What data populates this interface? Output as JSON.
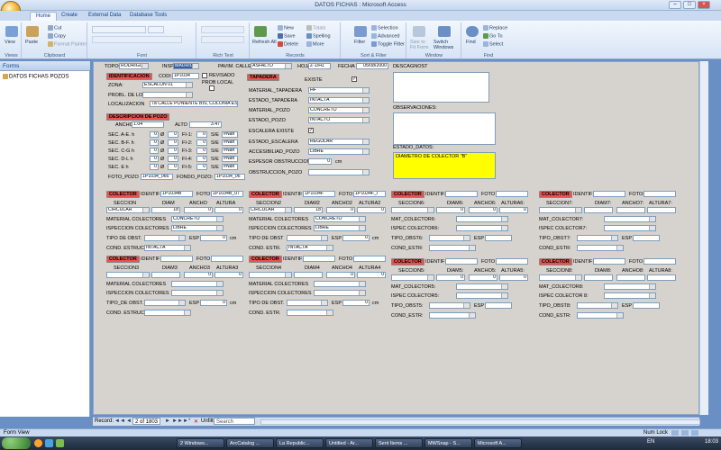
{
  "window": {
    "title": "DATOS FICHAS : Microsoft Access"
  },
  "tabs": [
    "Home",
    "Create",
    "External Data",
    "Database Tools"
  ],
  "ribbon": {
    "views": {
      "view": "View",
      "label": "Views"
    },
    "clipboard": {
      "paste": "Paste",
      "cut": "Cut",
      "copy": "Copy",
      "format_painter": "Format Painter",
      "label": "Clipboard"
    },
    "font": {
      "label": "Font"
    },
    "rich_text": {
      "label": "Rich Text"
    },
    "records": {
      "refresh": "Refresh All",
      "new": "New",
      "save": "Save",
      "delete": "Delete",
      "totals": "Totals",
      "spelling": "Spelling",
      "more": "More",
      "label": "Records"
    },
    "sort_filter": {
      "filter": "Filter",
      "selection": "Selection",
      "advanced": "Advanced",
      "toggle_filter": "Toggle Filter",
      "label": "Sort & Filter"
    },
    "window": {
      "size_to_fit": "Size to Fit Form",
      "switch_windows": "Switch Windows",
      "label": "Window"
    },
    "find": {
      "find": "Find",
      "replace": "Replace",
      "goto": "Go To",
      "select": "Select",
      "label": "Find"
    }
  },
  "nav": {
    "header": "Forms",
    "item": "DATOS FICHAS POZOS"
  },
  "form": {
    "topografo": {
      "label": "TOPOGR",
      "value": "RODRIGUEZ"
    },
    "inspector": {
      "label": "INSP",
      "value": "MAURICIO"
    },
    "pavim_calle": {
      "label": "PAVIM. CALLE",
      "value": "ASFALTO"
    },
    "hoja": {
      "label": "HOJA",
      "value": "Z-1/H1"
    },
    "fecha": {
      "label": "FECHA",
      "value": "05/08/2000"
    },
    "descagnost": "DESCAGNOST",
    "ident_hdr": "IDENTIFICACION",
    "codi": {
      "label": "CODI",
      "value": "1P1034"
    },
    "revisado": "REVISADO",
    "zona": {
      "label": "ZONA:",
      "value": "ESCALON 01"
    },
    "prob_local": "PROB LOCAL",
    "probl_local": {
      "label": "PROBL. DE LOCAL"
    },
    "localizacion": {
      "label": "LOCALIZACION",
      "value": "7a CALLE PONIENTE BIS, COLONIA ESCAL"
    },
    "desc_pozo_hdr": "DESCRIPCION DE POZO",
    "ancho": {
      "label": "ANCHO",
      "value": "1.04"
    },
    "alto": {
      "label": "ALTO",
      "value": "3.47"
    },
    "secs": [
      {
        "label": "SEC. A-E. h",
        "v1": "0",
        "diam": "0",
        "fl": "FI-1:",
        "fv": "0",
        "se": "S/E",
        "nan": "#Nan"
      },
      {
        "label": "SEC. B-F. h",
        "v1": "0",
        "diam": "0",
        "fl": "FI-2:",
        "fv": "0",
        "se": "S/E",
        "nan": "#Nan"
      },
      {
        "label": "SEC. C-G h",
        "v1": "0",
        "diam": "0",
        "fl": "FI-3:",
        "fv": "0",
        "se": "S/E",
        "nan": "#Nan"
      },
      {
        "label": "SEC. D-L h",
        "v1": "0",
        "diam": "0",
        "fl": "FI-4:",
        "fv": "0",
        "se": "S/E",
        "nan": "#Nan"
      },
      {
        "label": "SEC. E h",
        "v1": "0",
        "diam": "0",
        "fl": "FI-5:",
        "fv": "0",
        "se": "S/E",
        "nan": "#Nan"
      }
    ],
    "foto_pozo": {
      "label": "FOTO_POZO",
      "value": "1P1034_066"
    },
    "fondo_pozo": {
      "label": "FONDO_POZO:",
      "value": "1P1034_06"
    },
    "tapadera_hdr": "TAPADERA",
    "existe": "EXISTE",
    "material_tapadera": {
      "label": "MATERIAL_TAPADERA",
      "value": "HF"
    },
    "estado_tapadera": {
      "label": "ESTADO_TAPADERA",
      "value": "INTACTA"
    },
    "material_pozo": {
      "label": "MATERIAL_POZO",
      "value": "CONCRETO"
    },
    "estado_pozo": {
      "label": "ESTADO_POZO",
      "value": "INTACTO"
    },
    "escalera_existe": "ESCALERA EXISTE",
    "estado_escalera": {
      "label": "ESTADO_ESCALERA",
      "value": "REGULAR"
    },
    "accesibilidad": {
      "label": "ACCESIBILIAD_POZO",
      "value": "LIBRE"
    },
    "espesor_obstruccion": {
      "label": "ESPESOR OBSTRUCCION",
      "value": "0",
      "unit": "cm"
    },
    "obstruccion_pozo": {
      "label": "OBSTRUCCION_POZO"
    },
    "observaciones": "OBSERVACIONES:",
    "estado_datos": {
      "label": "ESTADO_DATOS:",
      "value": "DIAMETRO DE COLECTOR \"B\""
    },
    "colectors": [
      {
        "hdr": "COLECTOR",
        "ident_label": "IDENTIF",
        "ident": "1P1034B",
        "foto_label": "FOTO",
        "foto": "1P1034B_07",
        "sec_label": "SECCION",
        "diam_label": "DIAM",
        "ancho_label": "ANCHO",
        "altura_label": "ALTURA",
        "sec": "CIRCULAR",
        "diam": "18",
        "ancho": "0",
        "altura": "0",
        "mat_label": "MATERIAL COLECTORES",
        "mat": "CONCRETO",
        "insp_label": "ISPECCION COLECTORES",
        "insp": "LIBRE",
        "tipo_label": "TIPO DE OBST.",
        "esp_label": "ESP",
        "esp": "0",
        "esp_unit": "cm",
        "cond_label": "COND. ESTRUC",
        "cond": "INTACTA"
      },
      {
        "hdr": "COLECTOR",
        "ident_label": "IDENTIF",
        "ident": "1P1034F",
        "foto_label": "FOTO",
        "foto": "1P1034F_I",
        "sec_label": "SECCION2",
        "diam_label": "DIAM2",
        "ancho_label": "ANCHO2",
        "altura_label": "ALTURA2",
        "sec": "CIRCULAR",
        "diam": "18",
        "ancho": "0",
        "altura": "0",
        "mat_label": "MATERIAL COLECTORES",
        "mat": "CONCRETO",
        "insp_label": "ISPECCION COLECTORES",
        "insp": "LIBRE",
        "tipo_label": "TIPO DE OBST",
        "esp_label": "ESP",
        "esp": "0",
        "esp_unit": "cm",
        "cond_label": "COND. ESTR.",
        "cond": "INTACTA"
      },
      {
        "hdr": "COLECTOR",
        "ident_label": "IDENTIFI",
        "ident": "",
        "foto_label": "FOTO",
        "foto": "",
        "sec_label": "SECCION6:",
        "diam_label": "DIAM6:",
        "ancho_label": "ANCHO6:",
        "altura_label": "ALTURA6:",
        "sec": "",
        "diam": "0",
        "ancho": "0",
        "altura": "0",
        "mat_label": "MAT_COLECTOR6:",
        "mat": "",
        "insp_label": "ISPEC COLECTOR6:",
        "insp": "",
        "tipo_label": "TIPO_OBST6:",
        "esp_label": "ESP",
        "esp": "",
        "esp_unit": "",
        "cond_label": "COND_ESTR:",
        "cond": ""
      },
      {
        "hdr": "COLECTOR",
        "ident_label": "IDENTIF",
        "ident": "",
        "foto_label": "FOTO:",
        "foto": "",
        "sec_label": "SECCION7:",
        "diam_label": "DIAM7:",
        "ancho_label": "ANCHO7:",
        "altura_label": "ALTURA7:",
        "sec": "",
        "diam": "",
        "ancho": "",
        "altura": "",
        "mat_label": "MAT_COLECTOR7:",
        "mat": "",
        "insp_label": "ISPEC COLECTOR7:",
        "insp": "",
        "tipo_label": "TIPO_OBST7:",
        "esp_label": "ESP",
        "esp": "",
        "esp_unit": "",
        "cond_label": "COND_ESTR:",
        "cond": ""
      },
      {
        "hdr": "COLECTOR",
        "ident_label": "IDENTIF",
        "ident": "",
        "foto_label": "FOTO",
        "foto": "",
        "sec_label": "SECCION3",
        "diam_label": "DIAM3",
        "ancho_label": "ANCHO3",
        "altura_label": "ALTURA3",
        "sec": "",
        "diam": "",
        "ancho": "0",
        "altura": "0",
        "mat_label": "MATERIAL COLECTORES",
        "mat": "",
        "insp_label": "ISPECCION COLECTORES",
        "insp": "",
        "tipo_label": "TIPO_DE OBST.",
        "esp_label": "ESP",
        "esp": "0",
        "esp_unit": "cm",
        "cond_label": "COND. ESTRUC",
        "cond": ""
      },
      {
        "hdr": "COLECTOR",
        "ident_label": "IDENTIF",
        "ident": "",
        "foto_label": "FOTO",
        "foto": "",
        "sec_label": "SECCION4",
        "diam_label": "DIAM4",
        "ancho_label": "ANCHO4",
        "altura_label": "ALTURA4",
        "sec": "",
        "diam": "",
        "ancho": "0",
        "altura": "0",
        "mat_label": "MATERIAL COLECTORES",
        "mat": "",
        "insp_label": "ISPECCION COLECTORES",
        "insp": "",
        "tipo_label": "TIPO DE OBST.",
        "esp_label": "ESP",
        "esp": "0",
        "esp_unit": "cm",
        "cond_label": "COND. ESTR.",
        "cond": ""
      },
      {
        "hdr": "COLECTOR",
        "ident_label": "IDENTIF",
        "ident": "",
        "foto_label": "FOTO",
        "foto": "",
        "sec_label": "SECCION5:",
        "diam_label": "DIAM5:",
        "ancho_label": "ANCHO5:",
        "altura_label": "ALTURA5:",
        "sec": "",
        "diam": "0",
        "ancho": "0",
        "altura": "0",
        "mat_label": "MAT_COLECTOR5:",
        "mat": "",
        "insp_label": "ISPEC COLECTOR5:",
        "insp": "",
        "tipo_label": "TIPO_OBST5:",
        "esp_label": "ESP",
        "esp": "",
        "esp_unit": "",
        "cond_label": "COND_ESTR:",
        "cond": ""
      },
      {
        "hdr": "COLECTOR",
        "ident_label": "IDENTIF",
        "ident": "",
        "foto_label": "FOTO",
        "foto": "",
        "sec_label": "SECCION8:",
        "diam_label": "DIAM8:",
        "ancho_label": "ANCHO8:",
        "altura_label": "ALTURA8:",
        "sec": "",
        "diam": "",
        "ancho": "",
        "altura": "",
        "mat_label": "MAT_COLECTOR8:",
        "mat": "",
        "insp_label": "ISPEC COLECTOR 8:",
        "insp": "",
        "tipo_label": "TIPO_OBST8:",
        "esp_label": "ESP",
        "esp": "",
        "esp_unit": "",
        "cond_label": "COND_ESTR:",
        "cond": ""
      }
    ]
  },
  "statusbar": {
    "record": "Record:",
    "nav": "2 of 1803",
    "filter": "Unfiltered",
    "search": "Search"
  },
  "formview": {
    "label": "Form View",
    "num_lock": "Num Lock"
  },
  "taskbar": {
    "items": [
      "2 Windows...",
      "ArcCatalog ...",
      "La Republic...",
      "Untitled - Ar...",
      "Sent Items ...",
      "MWSnap - S...",
      "Microsoft A..."
    ],
    "lang": "EN",
    "clock": "18:03"
  },
  "colors": {
    "header_red": "#e8534f",
    "status_yellow": "#ffff00",
    "form_bg": "#d6d3ce"
  }
}
